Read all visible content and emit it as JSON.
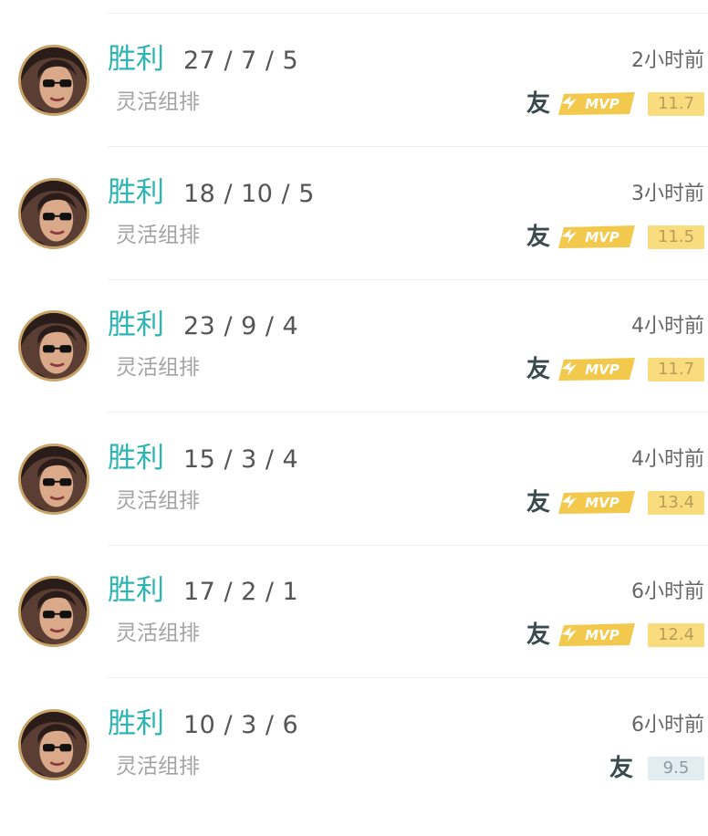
{
  "matches": [
    {
      "result": "胜利",
      "kda": "27 / 7 / 5",
      "mode": "灵活组排",
      "time": "2小时前",
      "friend_tag": "友",
      "mvp": true,
      "mvp_label": "MVP",
      "score": "11.7",
      "score_style": "gold"
    },
    {
      "result": "胜利",
      "kda": "18 / 10 / 5",
      "mode": "灵活组排",
      "time": "3小时前",
      "friend_tag": "友",
      "mvp": true,
      "mvp_label": "MVP",
      "score": "11.5",
      "score_style": "gold"
    },
    {
      "result": "胜利",
      "kda": "23 / 9 / 4",
      "mode": "灵活组排",
      "time": "4小时前",
      "friend_tag": "友",
      "mvp": true,
      "mvp_label": "MVP",
      "score": "11.7",
      "score_style": "gold"
    },
    {
      "result": "胜利",
      "kda": "15 / 3 / 4",
      "mode": "灵活组排",
      "time": "4小时前",
      "friend_tag": "友",
      "mvp": true,
      "mvp_label": "MVP",
      "score": "13.4",
      "score_style": "gold"
    },
    {
      "result": "胜利",
      "kda": "17 / 2 / 1",
      "mode": "灵活组排",
      "time": "6小时前",
      "friend_tag": "友",
      "mvp": true,
      "mvp_label": "MVP",
      "score": "12.4",
      "score_style": "gold"
    },
    {
      "result": "胜利",
      "kda": "10 / 3 / 6",
      "mode": "灵活组排",
      "time": "6小时前",
      "friend_tag": "友",
      "mvp": false,
      "score": "9.5",
      "score_style": "plain"
    }
  ],
  "colors": {
    "win": "#2bb5b3",
    "mvp_gold": "#f2c94c",
    "score_gold_bg": "#f9dc7e",
    "score_plain_bg": "#e3edf1"
  },
  "icons": {
    "avatar": "hero-portrait-icon",
    "mvp": "mvp-badge-icon"
  }
}
